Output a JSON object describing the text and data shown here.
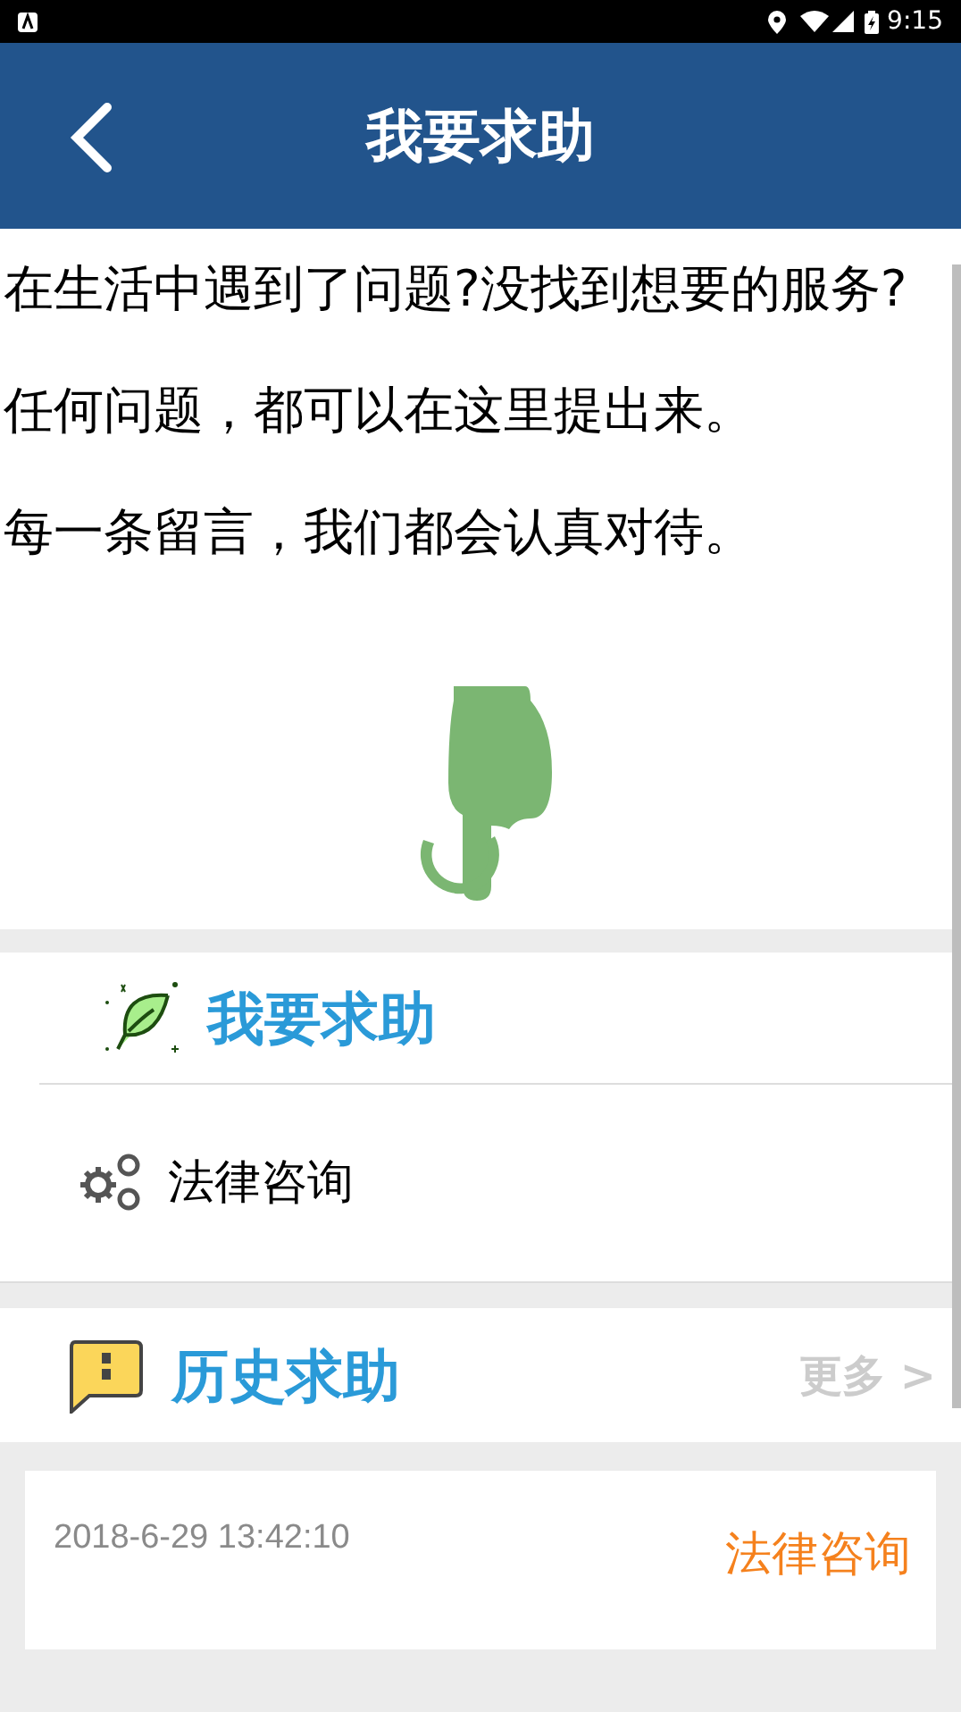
{
  "status_bar": {
    "time": "9:15"
  },
  "header": {
    "title": "我要求助"
  },
  "intro": [
    "在生活中遇到了问题?没找到想要的服务?",
    "任何问题，都可以在这里提出来。",
    "每一条留言，我们都会认真对待。"
  ],
  "help_section": {
    "title": "我要求助",
    "items": [
      {
        "label": "法律咨询"
      }
    ]
  },
  "history": {
    "title": "历史求助",
    "more": "更多 >",
    "entries": [
      {
        "time": "2018-6-29 13:42:10",
        "category": "法律咨询"
      }
    ]
  }
}
